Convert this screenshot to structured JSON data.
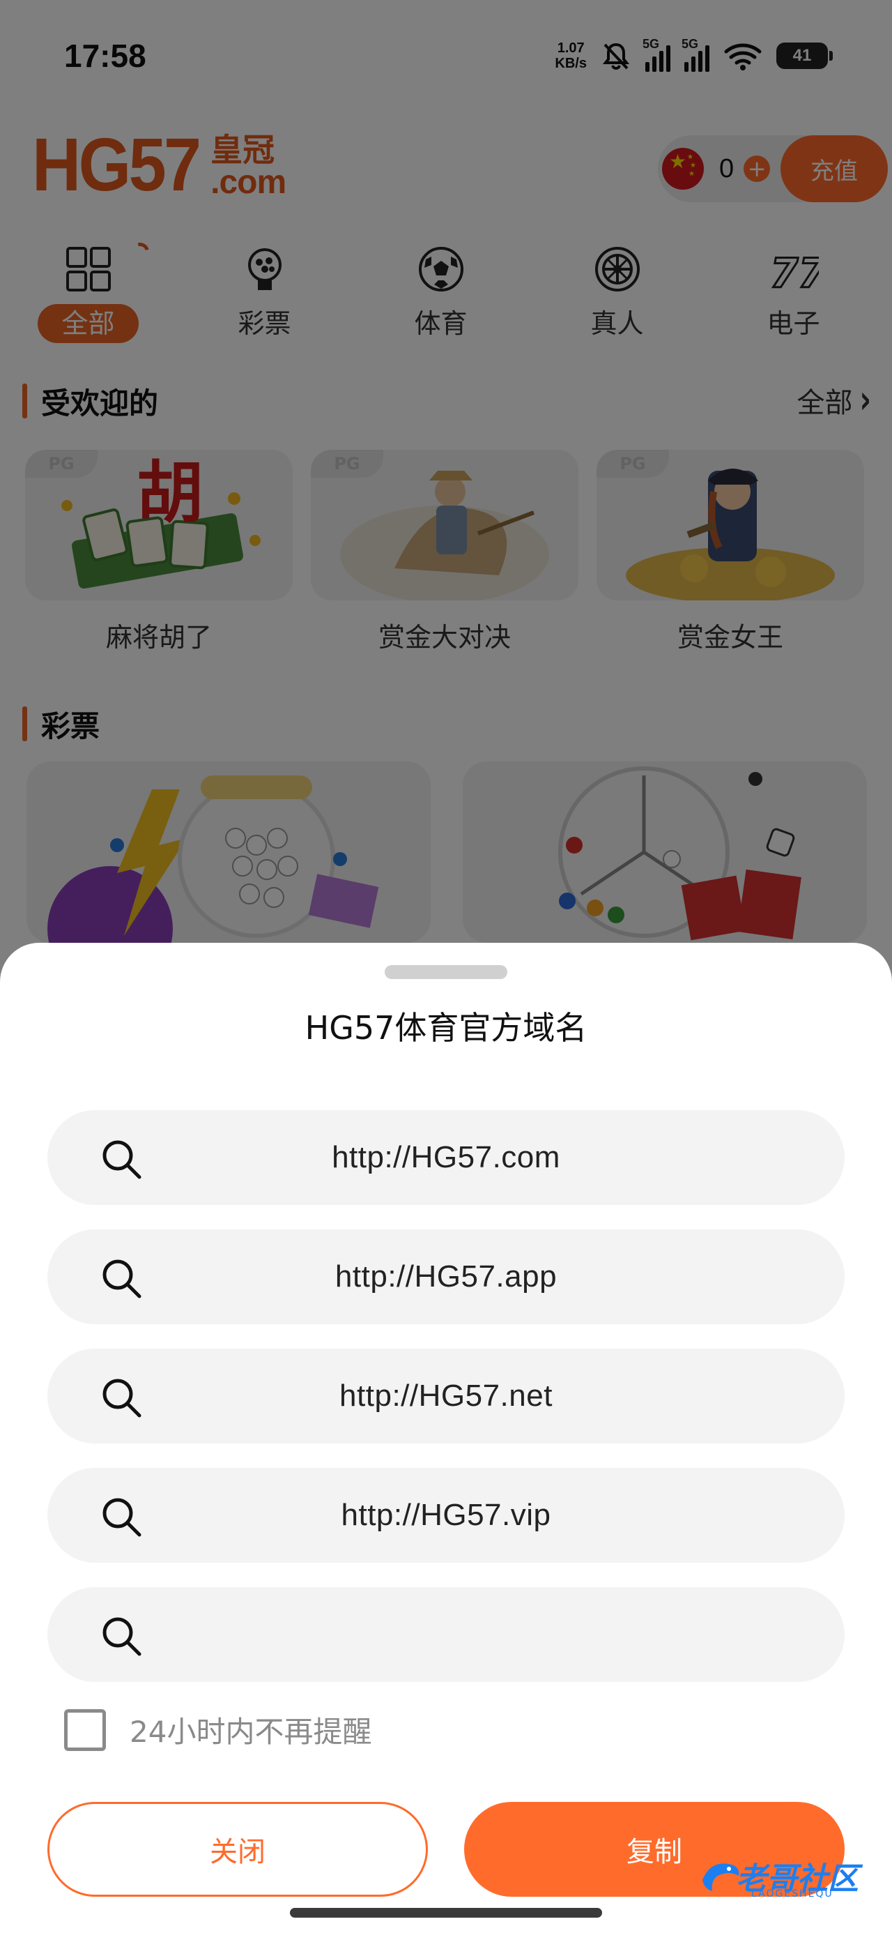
{
  "status_bar": {
    "time": "17:58",
    "net_speed_value": "1.07",
    "net_speed_unit": "KB/s",
    "sim1": "5G",
    "sim2": "5G",
    "battery": "41"
  },
  "header": {
    "logo_main": "HG57",
    "logo_cn": "皇冠",
    "logo_com": ".com",
    "balance": "0",
    "recharge_label": "充值"
  },
  "categories": [
    {
      "label": "全部",
      "icon": "grid-icon",
      "active": true
    },
    {
      "label": "彩票",
      "icon": "lottery-ball-icon",
      "active": false
    },
    {
      "label": "体育",
      "icon": "soccer-ball-icon",
      "active": false
    },
    {
      "label": "真人",
      "icon": "roulette-icon",
      "active": false
    },
    {
      "label": "电子",
      "icon": "slot-777-icon",
      "active": false
    }
  ],
  "popular": {
    "title": "受欢迎的",
    "more_label": "全部",
    "games": [
      {
        "tag": "PG",
        "name": "麻将胡了"
      },
      {
        "tag": "PG",
        "name": "赏金大对决"
      },
      {
        "tag": "PG",
        "name": "赏金女王"
      }
    ]
  },
  "lottery": {
    "title": "彩票"
  },
  "sheet": {
    "title": "HG57体育官方域名",
    "domains": [
      "http://HG57.com",
      "http://HG57.app",
      "http://HG57.net",
      "http://HG57.vip",
      ""
    ],
    "remind_label": "24小时内不再提醒",
    "close_label": "关闭",
    "copy_label": "复制"
  },
  "watermark": {
    "text": "老哥社区",
    "sub": "LAOGESHEQU"
  },
  "colors": {
    "accent": "#ff6b2b",
    "logo": "#e0591d",
    "overlay": "rgba(0,0,0,0.5)"
  }
}
